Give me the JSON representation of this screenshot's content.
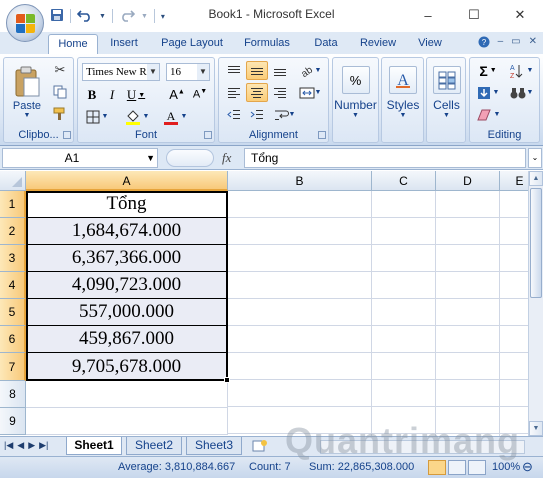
{
  "window": {
    "title": "Book1 - Microsoft Excel",
    "controls": [
      "–",
      "☐",
      "✕"
    ]
  },
  "quick_access": {
    "save_icon": "save-icon",
    "undo_icon": "undo-icon",
    "redo_icon": "redo-icon",
    "customize_icon": "customize-icon"
  },
  "ribbon_tabs": [
    "Home",
    "Insert",
    "Page Layout",
    "Formulas",
    "Data",
    "Review",
    "View"
  ],
  "ribbon": {
    "clipboard": {
      "label": "Clipbo...",
      "paste": "Paste"
    },
    "font": {
      "label": "Font",
      "name": "Times New Ro",
      "size": "16"
    },
    "alignment": {
      "label": "Alignment"
    },
    "number": {
      "label": "Number",
      "symbol": "%"
    },
    "styles": {
      "label": "Styles"
    },
    "cells": {
      "label": "Cells"
    },
    "editing": {
      "label": "Editing"
    }
  },
  "formula_bar": {
    "name_box": "A1",
    "fx": "fx",
    "content": "Tổng"
  },
  "columns": [
    "A",
    "B",
    "C",
    "D",
    "E"
  ],
  "rows": [
    "1",
    "2",
    "3",
    "4",
    "5",
    "6",
    "7",
    "8",
    "9"
  ],
  "cells": {
    "a1": "Tổng",
    "a2": "1,684,674.000",
    "a3": "6,367,366.000",
    "a4": "4,090,723.000",
    "a5": "557,000.000",
    "a6": "459,867.000",
    "a7": "9,705,678.000"
  },
  "sheets": [
    "Sheet1",
    "Sheet2",
    "Sheet3"
  ],
  "status": {
    "average": "Average: 3,810,884.667",
    "count": "Count: 7",
    "sum": "Sum: 22,865,308.000",
    "zoom": "100%"
  },
  "watermark": "Quantrimang",
  "colors": {
    "selected_header": "#f8c97a",
    "selected_cell": "#eaecf5"
  }
}
